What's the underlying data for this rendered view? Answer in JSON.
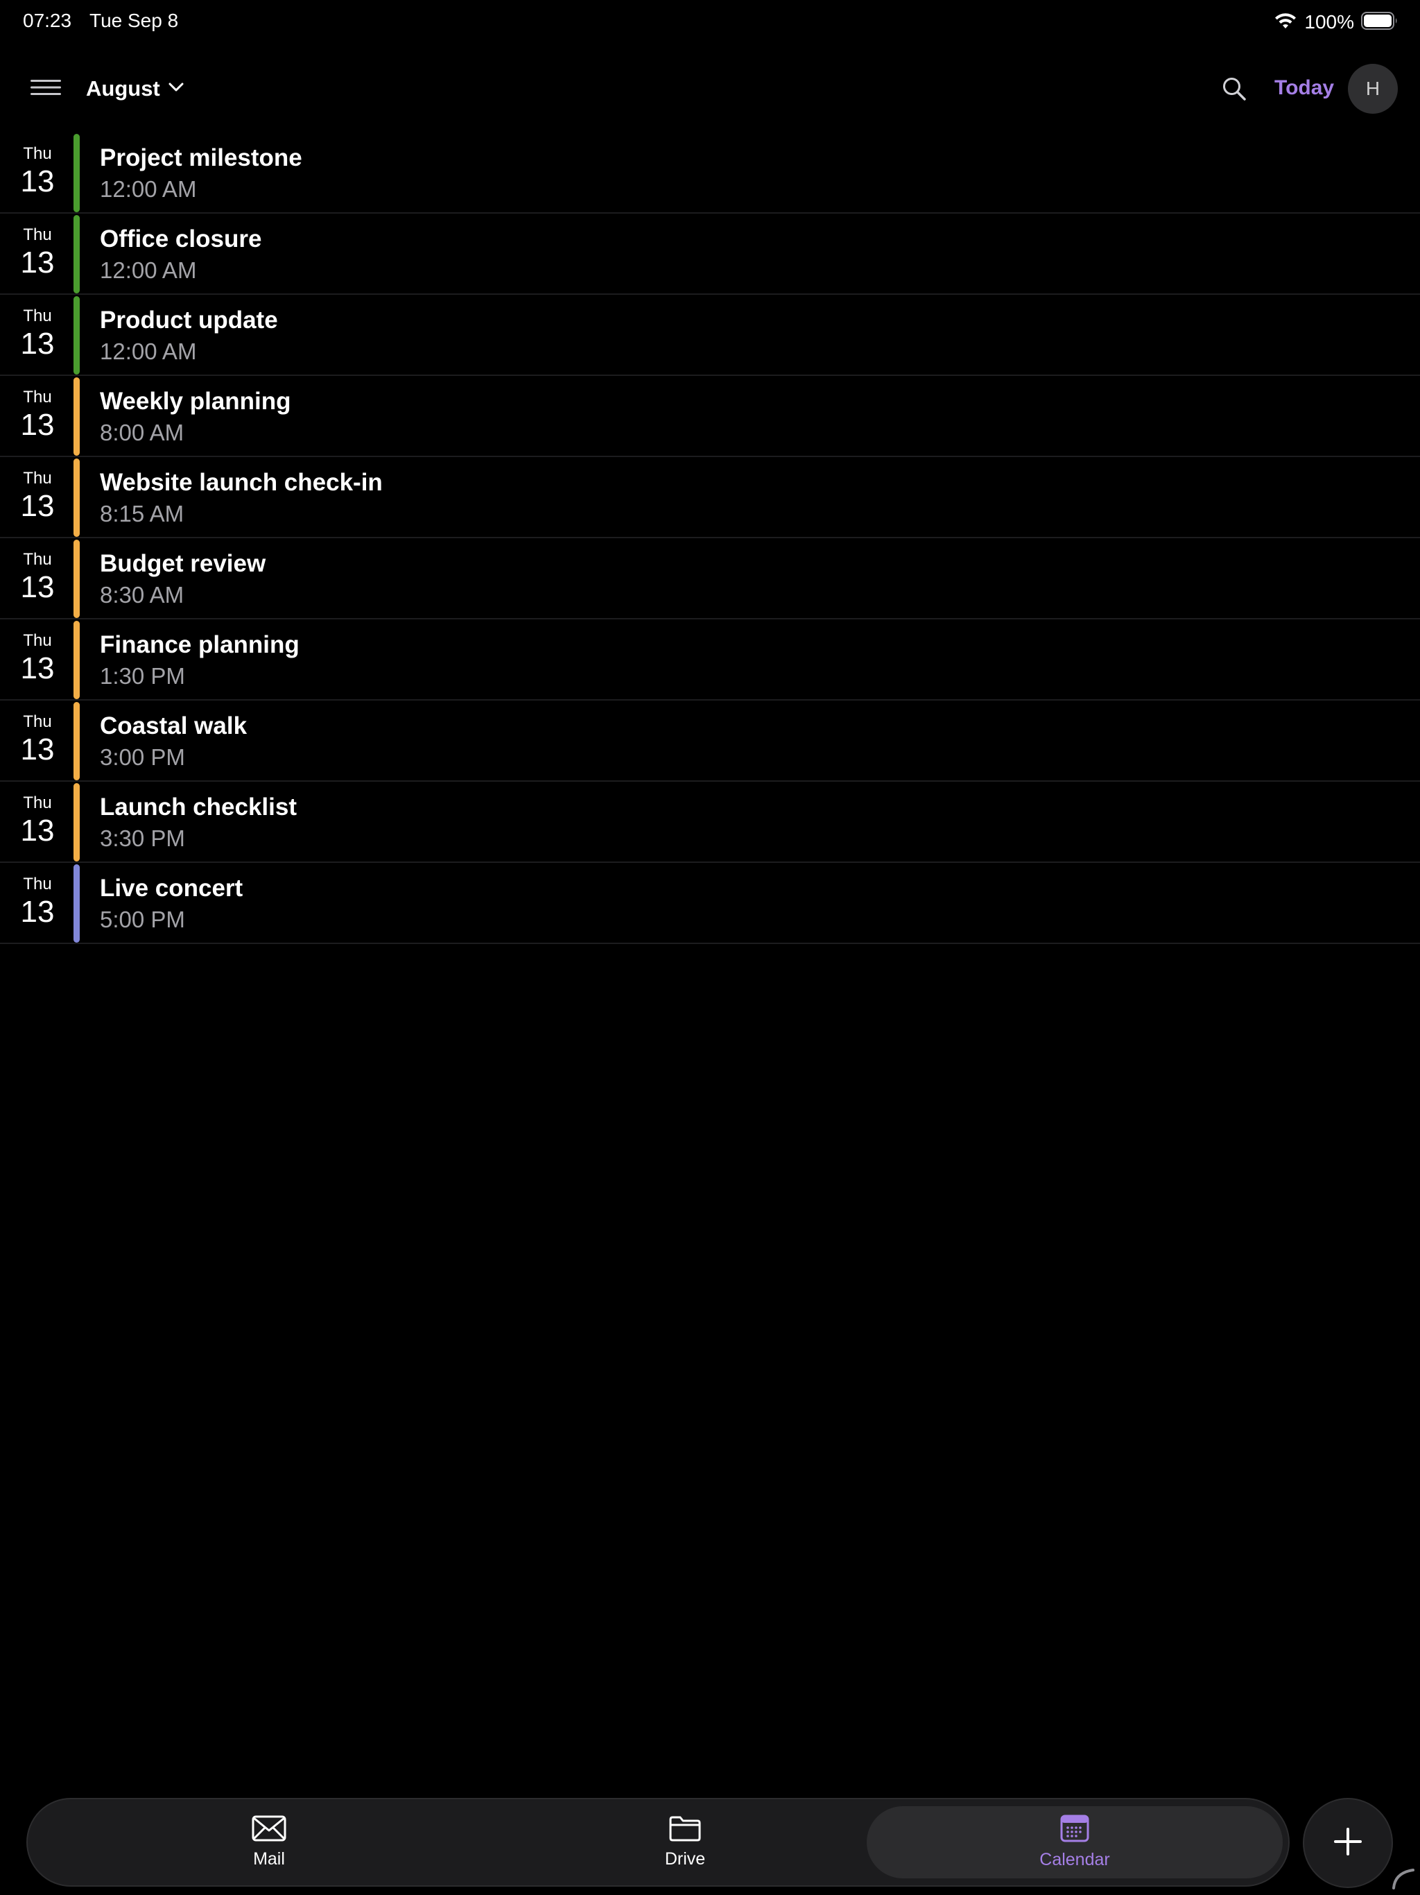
{
  "status_bar": {
    "time": "07:23",
    "date": "Tue Sep 8",
    "battery": "100%"
  },
  "header": {
    "month": "August",
    "today_label": "Today",
    "avatar_initial": "H"
  },
  "colors": {
    "accent": "#a57fe6",
    "green": "#4a9d2e",
    "orange": "#f3ae46",
    "purple": "#8187d9"
  },
  "events": [
    {
      "day": "Thu",
      "date": "13",
      "title": "Project milestone",
      "time": "12:00 AM",
      "color": "#4a9d2e"
    },
    {
      "day": "Thu",
      "date": "13",
      "title": "Office closure",
      "time": "12:00 AM",
      "color": "#4a9d2e"
    },
    {
      "day": "Thu",
      "date": "13",
      "title": "Product update",
      "time": "12:00 AM",
      "color": "#4a9d2e"
    },
    {
      "day": "Thu",
      "date": "13",
      "title": "Weekly planning",
      "time": "8:00 AM",
      "color": "#f3ae46"
    },
    {
      "day": "Thu",
      "date": "13",
      "title": "Website launch check-in",
      "time": "8:15 AM",
      "color": "#f3ae46"
    },
    {
      "day": "Thu",
      "date": "13",
      "title": "Budget review",
      "time": "8:30 AM",
      "color": "#f3ae46"
    },
    {
      "day": "Thu",
      "date": "13",
      "title": "Finance planning",
      "time": "1:30 PM",
      "color": "#f3ae46"
    },
    {
      "day": "Thu",
      "date": "13",
      "title": "Coastal walk",
      "time": "3:00 PM",
      "color": "#f3ae46"
    },
    {
      "day": "Thu",
      "date": "13",
      "title": "Launch checklist",
      "time": "3:30 PM",
      "color": "#f3ae46"
    },
    {
      "day": "Thu",
      "date": "13",
      "title": "Live concert",
      "time": "5:00 PM",
      "color": "#8187d9"
    }
  ],
  "tabs": {
    "mail": {
      "label": "Mail",
      "icon": "envelope-icon"
    },
    "drive": {
      "label": "Drive",
      "icon": "folder-icon"
    },
    "calendar": {
      "label": "Calendar",
      "icon": "calendar-icon",
      "selected": true
    }
  },
  "fab": {
    "icon": "plus-icon"
  }
}
